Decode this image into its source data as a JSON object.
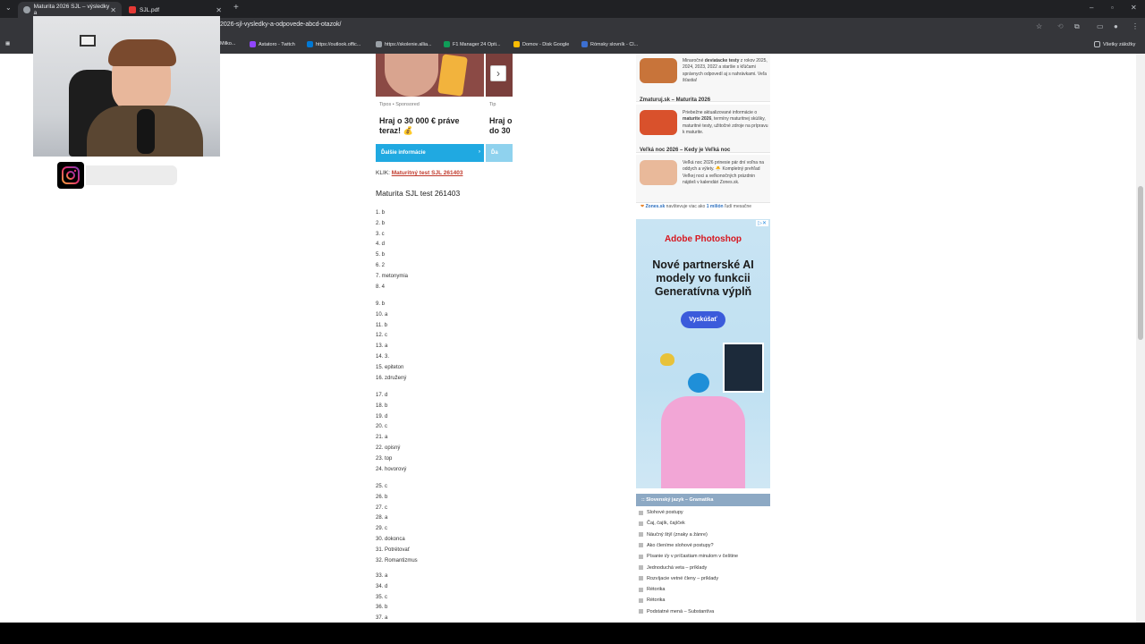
{
  "tabs": [
    {
      "title": "Maturita 2026 SJL – výsledky a",
      "active": true
    },
    {
      "title": "SJL.pdf",
      "active": false
    }
  ],
  "address": {
    "url": "2026-sjl-vysledky-a-odpovede-abcd-otazok/"
  },
  "bookmarks": [
    {
      "label": "Milko...",
      "color": "#7a5cff"
    },
    {
      "label": "Astatoro - Twitch",
      "color": "#9146ff"
    },
    {
      "label": "https://outlook.offic...",
      "color": "#0078d4"
    },
    {
      "label": "https://skolenie.allia...",
      "color": "#9aa0a6"
    },
    {
      "label": "F1 Manager 24 Opti...",
      "color": "#0f9d58"
    },
    {
      "label": "Domov - Disk Google",
      "color": "#fbbc04"
    },
    {
      "label": "Rómsky slovník - Cl...",
      "color": "#3c6fd1"
    }
  ],
  "bookmarks_all": "Všetky záložky",
  "ads": [
    {
      "source": "Tipos • Sponsored",
      "title": "Hraj o 30 000 € práve teraz! 💰",
      "button": "Ďalšie informácie"
    },
    {
      "source": "Tip",
      "title": "Hraj o do 30",
      "button": "Ďa"
    }
  ],
  "klik": {
    "prefix": "KLIK:",
    "link": "Maturitný test SJL 261403"
  },
  "test_title": "Maturita SJL test 261403",
  "answers": [
    "1. b",
    "2. b",
    "3. c",
    "4. d",
    "5. b",
    "6. 2",
    "7. metonymia",
    "8. 4",
    "9. b",
    "10. a",
    "11. b",
    "12. c",
    "13. a",
    "14. 3.",
    "15. epiteton",
    "16. združený",
    "17. d",
    "18. b",
    "19. d",
    "20. c",
    "21. a",
    "22. opisný",
    "23. top",
    "24. hovorový",
    "25. c",
    "26. b",
    "27. c",
    "28. a",
    "29. c",
    "30. dokonca",
    "31. Potrétovať",
    "32. Romantizmus",
    "33. a",
    "34. d",
    "35. c",
    "36. b",
    "37. a"
  ],
  "sidebar": {
    "items": [
      {
        "title": "",
        "text_pre": "Minaročné ",
        "text_bold": "deviatacke testy",
        "text_post": " z rokov 2025, 2024, 2023, 2022 a staršie s kľúčami správnych odpovedí aj s nahrávkami. Veľa šťastia!"
      },
      {
        "title": "Zmaturuj.sk – Maturita 2026",
        "text_pre": "Priebežne aktualizované informácie o ",
        "text_bold": "maturite 2026",
        "text_post": ", termíny maturitnej skúšky, maturitné testy, užitočné zdroje na prípravu k maturite."
      },
      {
        "title": "Veľká noc 2026 – Kedy je Veľká noc",
        "text_pre": "Veľká noc 2026 prinesie pár dní voľna na oddych a výlety. 🐣 Kompletný prehľad Veľkej noci a veľkonočných prázdnin nájdeš v kalendári Zones.sk.",
        "text_bold": "",
        "text_post": ""
      }
    ],
    "zones": {
      "brand": "Zones.sk",
      "text": "navštevuje viac ako",
      "count": "1 milión",
      "suffix": "ľudí mesačne"
    }
  },
  "adobe": {
    "brand": "Adobe Photoshop",
    "headline": "Nové partnerské AI modely vo funkcii Generatívna výplň",
    "cta": "Vyskúšať"
  },
  "grammar": {
    "heading": ":: Slovenský jazyk – Gramatika",
    "items": [
      "Slohové postupy",
      "Čaj, čajík, čajíček",
      "Náučný štýl (znaky a žánre)",
      "Ako členíme slohové postupy?",
      "Písanie i/y v príčastiam minulom v češtine",
      "Jednoduchá veta – príklady",
      "Rozvíjacie vetné členy – príklady",
      "Rétorika",
      "Rétorika",
      "Podstatné mená – Substantíva"
    ]
  },
  "colors": {
    "accent_blue": "#20a9e1",
    "link_red": "#c0392b",
    "adobe_red": "#d7171f",
    "adobe_btn": "#3b5bdb"
  }
}
